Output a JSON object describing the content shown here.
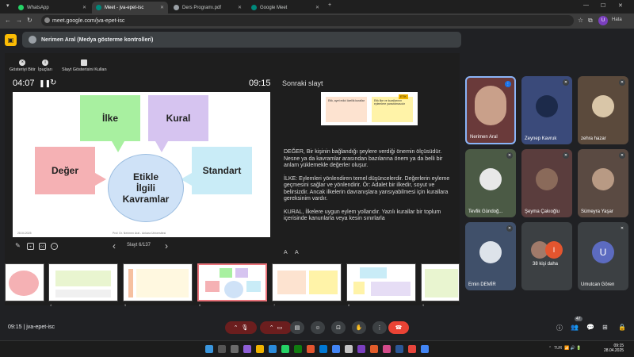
{
  "browser": {
    "tabs": [
      {
        "title": "WhatsApp",
        "color": "#25d366"
      },
      {
        "title": "Meet - jva-epet-isc",
        "color": "#00897b"
      },
      {
        "title": "Ders Programı.pdf",
        "color": "#9aa0a6"
      },
      {
        "title": "Google Meet",
        "color": "#00897b"
      }
    ],
    "new_tab": "+",
    "url": "meet.google.com/jva-epet-isc",
    "profile_initial": "U",
    "profile_label": "Hata"
  },
  "banner": {
    "text": "Nerimen Aral (Medya gösterme kontrolleri)"
  },
  "presenter": {
    "controls": [
      "Gösteriyi Bitir",
      "İpuçları",
      "Slayt Gösterisini Kullan"
    ],
    "timer": "04:07",
    "clock": "09:15",
    "next_label": "Sonraki slayt",
    "slide": {
      "boxes": [
        "İlke",
        "Kural",
        "Değer",
        "Standart"
      ],
      "center": [
        "Etikle",
        "İlgili",
        "Kavramlar"
      ],
      "footer_left": "28.04.2025",
      "footer_mid": "Prof. Dr. Nerimen Aral - Ankara Üniversitesi"
    },
    "next_slide": {
      "left_text": "Etik, ayırt edici özellik kurallar",
      "right_text": "Etik ilke ve kurallarının eylemlere yansıtılmasıdır",
      "badge": "ETİK"
    },
    "notes": [
      "DEĞER, Bir kişinin bağlandığı şeylere verdiği önemin ölçüsüdür. Nesne ya da kavramlar arasından bazılarına önem ya da belli bir anlam yüklemekle değerler oluşur.",
      "İLKE: Eylemleri yönlendiren temel düşüncelerdir. Değerlerin eyleme geçmesini sağlar ve yönlendirir. Ör: Adalet bir ilkedir, soyut ve belirsizdir. Ancak ilkelerin davranışlara yansıyabilmesi için kurallara gereksinim vardır.",
      " KURAL, İlkelere uygun eylem yollarıdır. Yazılı kurallar bir toplum içerisinde kanunlarla veya kesin sınırlarla"
    ],
    "slide_counter": "Slayt 6/137",
    "font_smaller": "A",
    "font_larger": "A",
    "filmstrip_numbers": [
      "4",
      "5",
      "6",
      "7",
      "8",
      "9"
    ]
  },
  "participants": [
    {
      "name": "Nerimen Aral",
      "bg": "#6a3a3a"
    },
    {
      "name": "Zeynep Kavruk",
      "bg": "#3a4a7a"
    },
    {
      "name": "zehra hazar",
      "bg": "#5b4a3c"
    },
    {
      "name": "Tevfik Gündoğ...",
      "bg": "#4b5a45"
    },
    {
      "name": "Şeyma Çakıoğlu",
      "bg": "#5a3d3d"
    },
    {
      "name": "Sümeyra Yaşar",
      "bg": "#5a4a42"
    },
    {
      "name": "Emin DEMİR",
      "bg": "#40506a"
    },
    {
      "name": "38 kişi daha",
      "bg": "#3c4043"
    },
    {
      "name": "Umutcan Gören",
      "bg": "#3c4043"
    }
  ],
  "avatar_initial": "U",
  "more_initial": "I",
  "bottombar": {
    "time": "09:15",
    "code": "jva-epet-isc",
    "participant_count": "47"
  },
  "taskbar": {
    "lang": "TUR",
    "time": "09:15",
    "date": "28.04.2025"
  }
}
